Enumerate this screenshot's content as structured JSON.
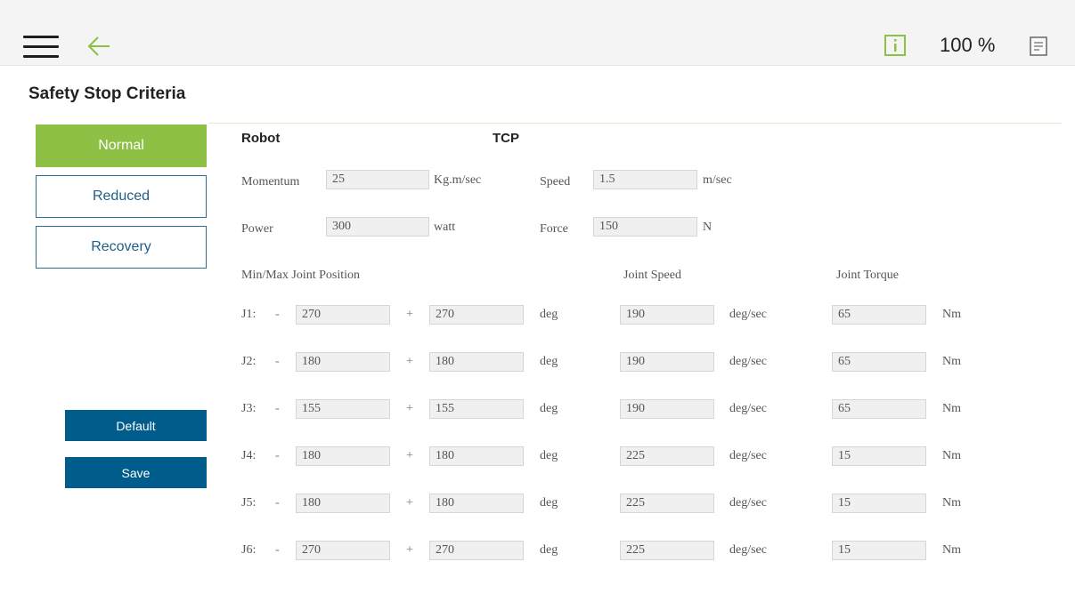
{
  "header": {
    "zoom": "100 %",
    "menu_icon": "hamburger-menu-icon",
    "back_icon": "arrow-left-icon",
    "info_icon": "info-icon",
    "doc_icon": "document-icon",
    "accent_color": "#8dc044"
  },
  "page": {
    "title": "Safety Stop Criteria"
  },
  "modes": [
    {
      "label": "Normal",
      "active": true
    },
    {
      "label": "Reduced",
      "active": false
    },
    {
      "label": "Recovery",
      "active": false
    }
  ],
  "actions": {
    "default_label": "Default",
    "save_label": "Save"
  },
  "robot": {
    "heading": "Robot",
    "momentum_label": "Momentum",
    "momentum_value": "25",
    "momentum_unit": "Kg.m/sec",
    "power_label": "Power",
    "power_value": "300",
    "power_unit": "watt"
  },
  "tcp": {
    "heading": "TCP",
    "speed_label": "Speed",
    "speed_value": "1.5",
    "speed_unit": "m/sec",
    "force_label": "Force",
    "force_value": "150",
    "force_unit": "N"
  },
  "joints": {
    "position_header": "Min/Max Joint Position",
    "speed_header": "Joint Speed",
    "torque_header": "Joint Torque",
    "minus": "-",
    "plus": "+",
    "pos_unit": "deg",
    "speed_unit": "deg/sec",
    "torque_unit": "Nm",
    "rows": [
      {
        "label": "J1:",
        "min": "270",
        "max": "270",
        "speed": "190",
        "torque": "65"
      },
      {
        "label": "J2:",
        "min": "180",
        "max": "180",
        "speed": "190",
        "torque": "65"
      },
      {
        "label": "J3:",
        "min": "155",
        "max": "155",
        "speed": "190",
        "torque": "65"
      },
      {
        "label": "J4:",
        "min": "180",
        "max": "180",
        "speed": "225",
        "torque": "15"
      },
      {
        "label": "J5:",
        "min": "180",
        "max": "180",
        "speed": "225",
        "torque": "15"
      },
      {
        "label": "J6:",
        "min": "270",
        "max": "270",
        "speed": "225",
        "torque": "15"
      }
    ]
  }
}
